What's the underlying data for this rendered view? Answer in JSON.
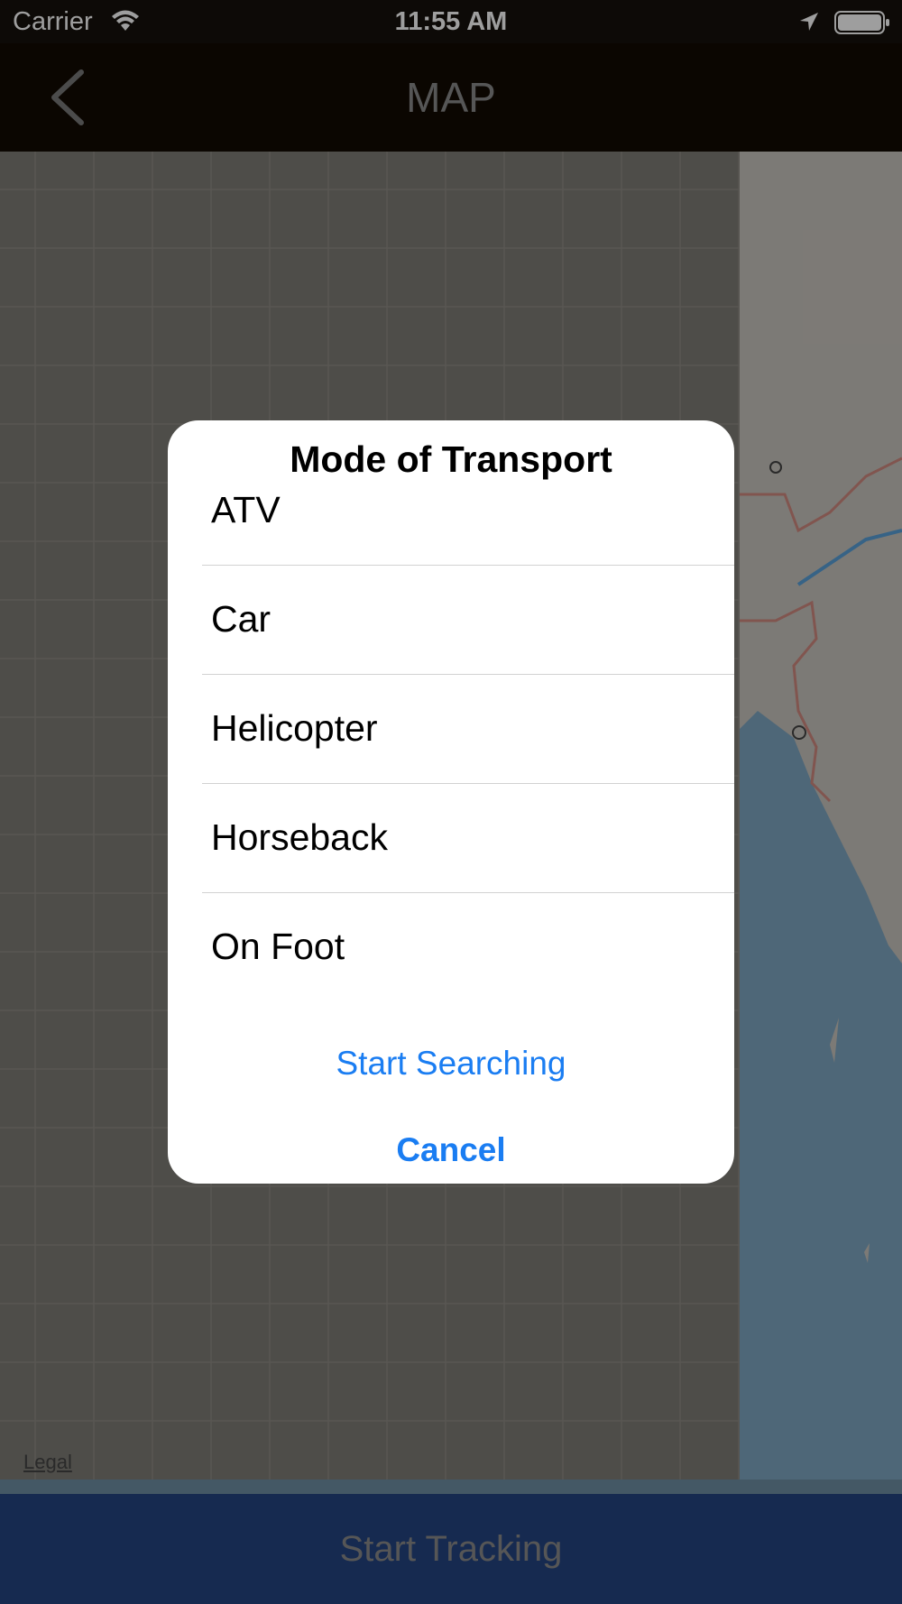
{
  "status_bar": {
    "carrier": "Carrier",
    "time": "11:55 AM",
    "icons": [
      "wifi-icon",
      "location-icon",
      "battery-icon"
    ]
  },
  "nav": {
    "title": "MAP",
    "back_icon": "chevron-left-icon"
  },
  "map": {
    "legal_link": "Legal"
  },
  "dialog": {
    "title": "Mode of Transport",
    "options": [
      "ATV",
      "Car",
      "Helicopter",
      "Horseback",
      "On Foot"
    ],
    "primary_action": "Start Searching",
    "cancel_action": "Cancel"
  },
  "bottom_button": {
    "label": "Start Tracking"
  },
  "colors": {
    "nav_background": "#120a03",
    "accent_blue": "#1a7df2",
    "bottom_button": "#254582"
  }
}
